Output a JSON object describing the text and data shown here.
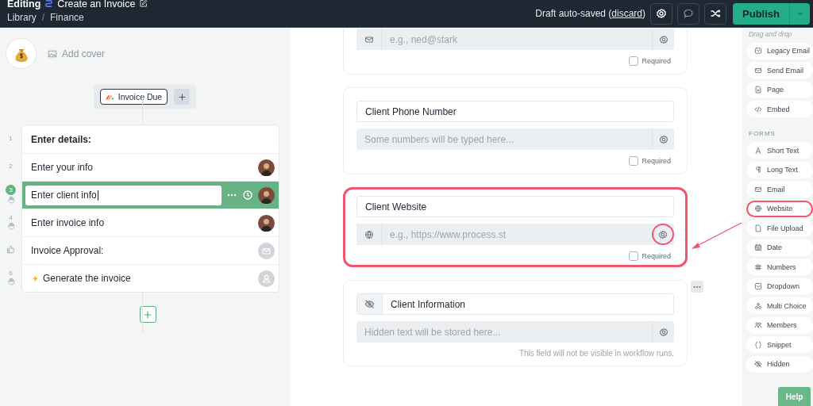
{
  "header": {
    "mode": "Editing",
    "title": "Create an Invoice",
    "breadcrumb": [
      "Library",
      "Finance"
    ],
    "breadcrumb_separator": "/",
    "draft_status": "Draft auto-saved",
    "discard_open": "(",
    "discard_link": "discard",
    "discard_close": ")",
    "publish_button": "Publish"
  },
  "cover": {
    "add_cover": "Add cover"
  },
  "trigger": {
    "label": "Invoice Due"
  },
  "steps": [
    {
      "number": "1",
      "label": "Enter details:",
      "kind": "heading",
      "stop": false,
      "automated": false,
      "selected": false
    },
    {
      "number": "2",
      "label": "Enter your info",
      "kind": "task",
      "stop": false,
      "automated": false,
      "selected": false
    },
    {
      "number": "3",
      "label": "Enter client info",
      "kind": "task",
      "stop": true,
      "automated": false,
      "selected": true
    },
    {
      "number": "4",
      "label": "Enter invoice info",
      "kind": "task",
      "stop": true,
      "automated": false,
      "selected": false
    },
    {
      "label": "Invoice Approval:",
      "kind": "approval",
      "stop": false,
      "automated": false,
      "selected": false
    },
    {
      "number": "6",
      "label": "Generate the invoice",
      "kind": "task",
      "stop": true,
      "automated": true,
      "selected": false
    }
  ],
  "form_cards": [
    {
      "kind": "email",
      "placeholder": "e.g., ned@stark",
      "required": {
        "label": "Required",
        "checked": false
      },
      "highlighted": false,
      "gear_circled": false,
      "menu": false
    },
    {
      "kind": "phone",
      "title": "Client Phone Number",
      "placeholder": "Some numbers will be typed here...",
      "required": {
        "label": "Required",
        "checked": false
      },
      "highlighted": false,
      "gear_circled": false,
      "menu": false
    },
    {
      "kind": "website",
      "title": "Client Website",
      "placeholder": "e.g., https://www.process.st",
      "required": {
        "label": "Required",
        "checked": false
      },
      "highlighted": true,
      "gear_circled": true,
      "menu": false
    },
    {
      "kind": "hidden",
      "title": "Client Information",
      "placeholder": "Hidden text will be stored here...",
      "note": "This field will not be visible in workflow runs.",
      "highlighted": false,
      "gear_circled": false,
      "menu": true
    }
  ],
  "sidebar": {
    "hint": "Drag and drop",
    "sections": [
      {
        "items": [
          {
            "label": "Legacy Email",
            "highlighted": false
          },
          {
            "label": "Send Email",
            "highlighted": false
          },
          {
            "label": "Page",
            "highlighted": false
          },
          {
            "label": "Embed",
            "highlighted": false
          }
        ]
      },
      {
        "title": "FORMS",
        "items": [
          {
            "label": "Short Text",
            "highlighted": false
          },
          {
            "label": "Long Text",
            "highlighted": false
          },
          {
            "label": "Email",
            "highlighted": false
          },
          {
            "label": "Website",
            "highlighted": true
          },
          {
            "label": "File Upload",
            "highlighted": false
          },
          {
            "label": "Date",
            "highlighted": false
          },
          {
            "label": "Numbers",
            "highlighted": false
          },
          {
            "label": "Dropdown",
            "highlighted": false
          },
          {
            "label": "Multi Choice",
            "highlighted": false
          },
          {
            "label": "Members",
            "highlighted": false
          },
          {
            "label": "Snippet",
            "highlighted": false
          },
          {
            "label": "Hidden",
            "highlighted": false
          }
        ]
      }
    ]
  },
  "help_button": "Help"
}
